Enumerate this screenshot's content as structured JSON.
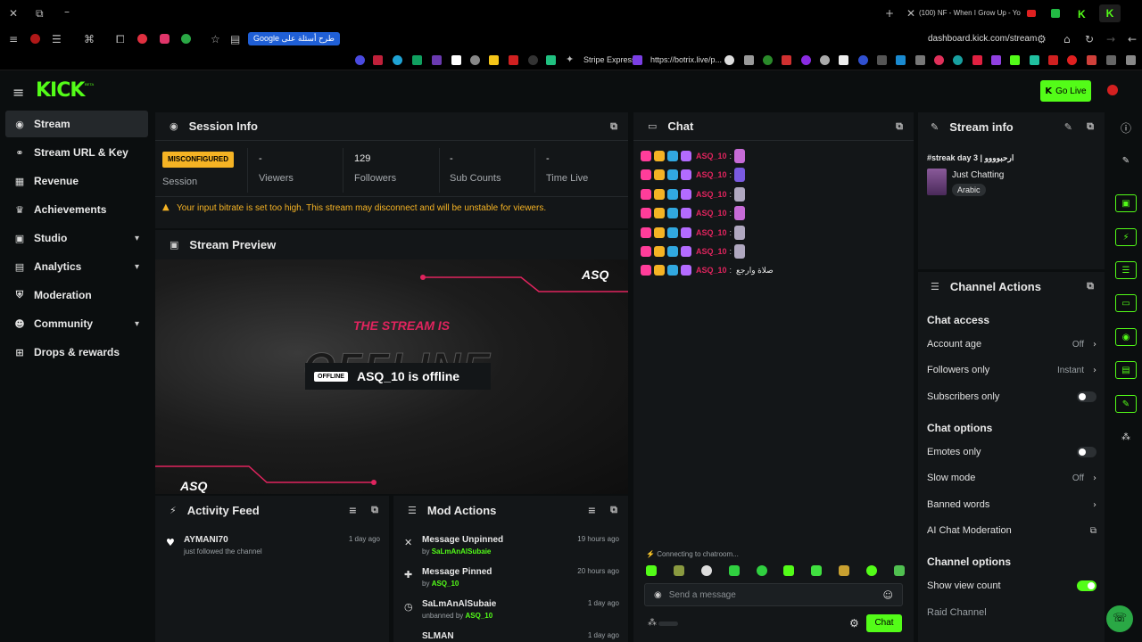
{
  "browser": {
    "bookmark_google": "Google طرح أسئلة على",
    "tab_title": "(100) NF - When I Grow Up - Yo",
    "url": "dashboard.kick.com/stream",
    "bookmark_stripe": "Stripe Express",
    "bookmark_botrix": "https://botrix.live/p..."
  },
  "app": {
    "logo": "KICK",
    "logo_sup": "BETA",
    "go_live": "Go Live"
  },
  "sidebar": {
    "items": [
      {
        "label": "Stream",
        "icon": "broadcast-icon"
      },
      {
        "label": "Stream URL & Key",
        "icon": "link-icon"
      },
      {
        "label": "Revenue",
        "icon": "chart-icon"
      },
      {
        "label": "Achievements",
        "icon": "trophy-icon"
      },
      {
        "label": "Studio",
        "icon": "studio-icon"
      },
      {
        "label": "Analytics",
        "icon": "analytics-icon"
      },
      {
        "label": "Moderation",
        "icon": "shield-icon"
      },
      {
        "label": "Community",
        "icon": "people-icon"
      },
      {
        "label": "Drops & rewards",
        "icon": "gift-icon"
      }
    ]
  },
  "session": {
    "title": "Session Info",
    "status_badge": "MISCONFIGURED",
    "status_label": "Session",
    "stats": [
      {
        "value": "-",
        "label": "Viewers"
      },
      {
        "value": "129",
        "label": "Followers"
      },
      {
        "value": "-",
        "label": "Sub Counts"
      },
      {
        "value": "-",
        "label": "Time Live"
      }
    ],
    "warning": "Your input bitrate is set too high. This stream may disconnect and will be unstable for viewers."
  },
  "preview": {
    "title": "Stream Preview",
    "watermark": "ASQ",
    "stream_is": "THE STREAM IS",
    "offline_big": "OFFLINE",
    "offline_badge": "OFFLINE",
    "offline_text": "ASQ_10 is offline",
    "watermark_bottom": "ASQ"
  },
  "activity": {
    "title": "Activity Feed",
    "items": [
      {
        "user": "AYMANI70",
        "action": "just followed the channel",
        "time": "1 day ago"
      }
    ]
  },
  "mod": {
    "title": "Mod Actions",
    "items": [
      {
        "action": "Message Unpinned",
        "by_prefix": "by",
        "by": "SaLmAnAlSubaie",
        "time": "19 hours ago"
      },
      {
        "action": "Message Pinned",
        "by_prefix": "by",
        "by": "ASQ_10",
        "time": "20 hours ago"
      },
      {
        "action": "SaLmAnAlSubaie",
        "by_prefix": "unbanned by",
        "by": "ASQ_10",
        "time": "1 day ago"
      },
      {
        "action": "SLMAN",
        "by_prefix": "",
        "by": "",
        "time": "1 day ago"
      }
    ]
  },
  "chat": {
    "title": "Chat",
    "messages": [
      {
        "user": "ASQ_10",
        "text": ""
      },
      {
        "user": "ASQ_10",
        "text": ""
      },
      {
        "user": "ASQ_10",
        "text": ""
      },
      {
        "user": "ASQ_10",
        "text": ""
      },
      {
        "user": "ASQ_10",
        "text": ""
      },
      {
        "user": "ASQ_10",
        "text": ""
      },
      {
        "user": "ASQ_10",
        "text": "صلاة وارجع"
      }
    ],
    "connecting": "Connecting to chatroom...",
    "placeholder": "Send a message",
    "send": "Chat"
  },
  "stream_info": {
    "title": "Stream info",
    "stream_title": "#streak day 3 | ارحبوووو",
    "category": "Just Chatting",
    "tag": "Arabic"
  },
  "channel_actions": {
    "title": "Channel Actions",
    "chat_access": "Chat access",
    "account_age": "Account age",
    "account_age_value": "Off",
    "followers_only": "Followers only",
    "followers_only_value": "Instant",
    "subscribers_only": "Subscribers only",
    "subscribers_only_on": false,
    "chat_options": "Chat options",
    "emotes_only": "Emotes only",
    "emotes_only_on": false,
    "slow_mode": "Slow mode",
    "slow_mode_value": "Off",
    "banned_words": "Banned words",
    "ai_moderation": "AI Chat Moderation",
    "channel_options": "Channel options",
    "show_view_count": "Show view count",
    "show_view_count_on": true,
    "raid_channel": "Raid Channel"
  },
  "colors": {
    "accent": "#53fc18",
    "chat_user": "#e0245e",
    "misconfigured": "#f5b324"
  }
}
